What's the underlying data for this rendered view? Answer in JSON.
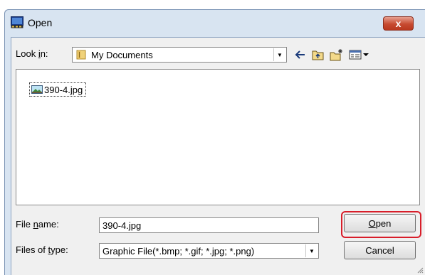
{
  "window": {
    "title": "Open",
    "close_label": "x",
    "icon": "window-app-icon"
  },
  "lookin": {
    "label_pre": "Look ",
    "label_key": "i",
    "label_post": "n:",
    "value": "My Documents",
    "icon": "folder-icon"
  },
  "toolbar": {
    "back_icon": "back-arrow-icon",
    "up_icon": "up-folder-icon",
    "new_folder_icon": "new-folder-icon",
    "view_icon": "view-menu-icon"
  },
  "files": [
    {
      "name": "390-4.jpg",
      "icon": "image-file-icon"
    }
  ],
  "filename": {
    "label_pre": "File ",
    "label_key": "n",
    "label_post": "ame:",
    "value": "390-4.jpg"
  },
  "filetype": {
    "label_pre": "Files of ",
    "label_key": "t",
    "label_post": "ype:",
    "value": "Graphic File(*.bmp; *.gif; *.jpg; *.png)"
  },
  "buttons": {
    "open_key": "O",
    "open_rest": "pen",
    "cancel": "Cancel"
  },
  "colors": {
    "highlight": "#d81e2a",
    "close": "#c74b31"
  }
}
